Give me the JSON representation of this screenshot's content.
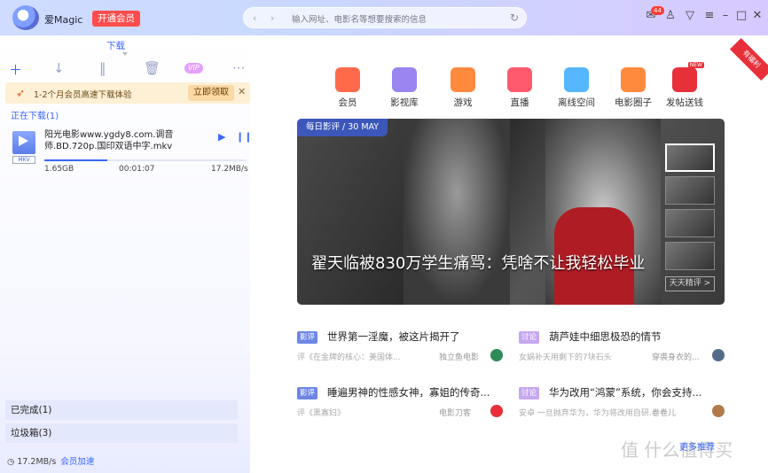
{
  "app": {
    "name": "爱Magic",
    "vip_button": "开通会员"
  },
  "urlbar": {
    "nav": "‹ ›",
    "placeholder": "输入网址、电影名等想要搜索的信息",
    "refresh": "↻"
  },
  "toolbar": {
    "mail_badge": "44",
    "icons": [
      "mail-icon",
      "shirt-icon",
      "download-icon",
      "menu-icon",
      "minimize-icon",
      "maximize-icon",
      "close-icon"
    ]
  },
  "download_panel": {
    "tab_label": "下载",
    "vip_tag": "VIP",
    "promo": {
      "text": "1-2个月会员高速下载体验",
      "button": "立即领取",
      "close": "✕"
    },
    "downloading_header": "正在下载(1)",
    "item": {
      "ext": "MKV",
      "filename": "阳光电影www.ygdy8.com.调音师.BD.720p.国印双语中字.mkv",
      "size": "1.65GB",
      "elapsed": "00:01:07",
      "speed": "17.2MB/s",
      "progress": 0.31
    },
    "completed": "已完成(1)",
    "trash": "垃圾箱(3)",
    "footer_speed": "17.2MB/s",
    "footer_accel": "会员加速"
  },
  "categories": [
    {
      "label": "会员",
      "color": "#ff6b4a"
    },
    {
      "label": "影视库",
      "color": "#9b86f0"
    },
    {
      "label": "游戏",
      "color": "#ff8a3d"
    },
    {
      "label": "直播",
      "color": "#ff5a6e"
    },
    {
      "label": "离线空间",
      "color": "#55b7ff"
    },
    {
      "label": "电影圈子",
      "color": "#ff8a3d"
    },
    {
      "label": "发帖送钱",
      "color": "#e8303a",
      "badge": "NEW"
    }
  ],
  "corner_ribbon": "有福利",
  "hero": {
    "tag": "每日影评 / 30 MAY",
    "title": "翟天临被830万学生痛骂：凭啥不让我轻松毕业",
    "more": "天天精评 >"
  },
  "posts": [
    {
      "tag": "影评",
      "title": "世界第一淫魔，被这片揭开了",
      "sub": "评《在金牌的核心：美国体...",
      "author": "独立鱼电影",
      "avatar": "#2e8b57"
    },
    {
      "tag": "讨论",
      "title": "葫芦娃中细思极恐的情节",
      "sub": "女娲补天用剩下的7块石头",
      "author": "穿裘身衣的...",
      "avatar": "#556b8a"
    },
    {
      "tag": "影评",
      "title": "睡遍男神的性感女神，寡姐的传奇...",
      "sub": "评《黑寡妇》",
      "author": "电影刀客",
      "avatar": "#e8303a"
    },
    {
      "tag": "讨论",
      "title": "华为改用“鸿蒙”系统，你会支持...",
      "sub": "安卓 一旦抛弃华为，华为将改用自研...",
      "author": "卷卷儿",
      "avatar": "#b07a4a"
    }
  ],
  "more_link": "更多推荐",
  "watermark": "值 什么值得买"
}
